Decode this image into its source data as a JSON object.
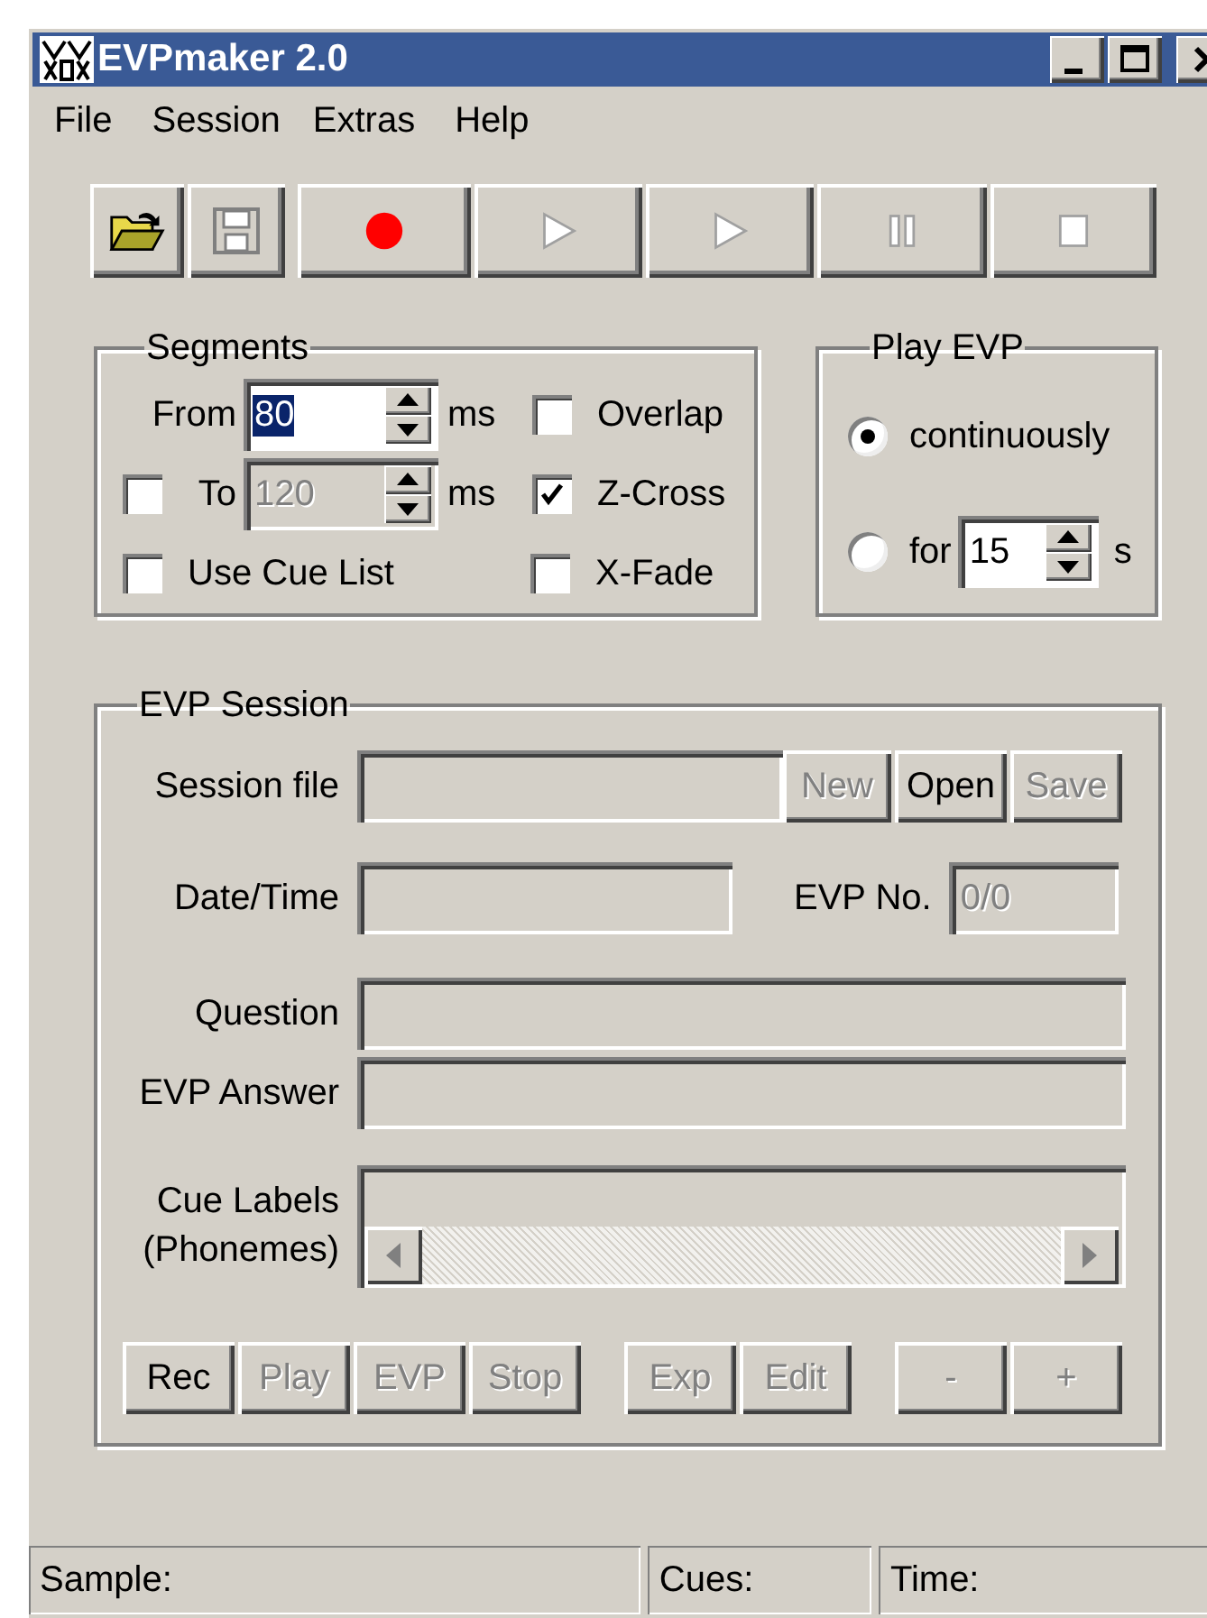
{
  "window": {
    "title": "EVPmaker 2.0"
  },
  "menu": [
    {
      "label": "File"
    },
    {
      "label": "Session"
    },
    {
      "label": "Extras"
    },
    {
      "label": "Help"
    }
  ],
  "toolbar": [
    {
      "kind": "open",
      "disabled": false
    },
    {
      "kind": "save",
      "disabled": true
    },
    {
      "kind": "record",
      "disabled": false
    },
    {
      "kind": "play",
      "disabled": true
    },
    {
      "kind": "play",
      "disabled": true
    },
    {
      "kind": "pause",
      "disabled": true
    },
    {
      "kind": "stop",
      "disabled": true
    }
  ],
  "segments": {
    "title": "Segments",
    "from": {
      "label": "From",
      "value": "80",
      "value_selected": true,
      "unit": "ms",
      "disabled": false
    },
    "to": {
      "label": "To",
      "checked": false,
      "value": "120",
      "unit": "ms",
      "disabled": true
    },
    "use_cue_list": {
      "label": "Use Cue List",
      "checked": false
    },
    "options": [
      {
        "label": "Overlap",
        "checked": false
      },
      {
        "label": "Z-Cross",
        "checked": true
      },
      {
        "label": "X-Fade",
        "checked": false
      }
    ]
  },
  "play_evp": {
    "title": "Play EVP",
    "options": [
      {
        "kind": "plain",
        "label": "continuously",
        "selected": true
      },
      {
        "kind": "duration",
        "label": "for",
        "selected": false,
        "value": "15",
        "unit": "s"
      }
    ]
  },
  "session": {
    "title": "EVP Session",
    "file": {
      "label": "Session file",
      "buttons": [
        {
          "label": "New",
          "disabled": true
        },
        {
          "label": "Open",
          "disabled": false
        },
        {
          "label": "Save",
          "disabled": true
        }
      ]
    },
    "date": {
      "label": "Date/Time"
    },
    "evp_no": {
      "label": "EVP No.",
      "value": "0/0"
    },
    "question": {
      "label": "Question"
    },
    "answer": {
      "label": "EVP Answer"
    },
    "cue_labels": {
      "label": "Cue Labels",
      "sublabel": "(Phonemes)"
    },
    "button_groups": [
      {
        "buttons": [
          {
            "label": "Rec",
            "disabled": false
          },
          {
            "label": "Play",
            "disabled": true
          },
          {
            "label": "EVP",
            "disabled": true
          },
          {
            "label": "Stop",
            "disabled": true
          }
        ]
      },
      {
        "buttons": [
          {
            "label": "Exp",
            "disabled": true
          },
          {
            "label": "Edit",
            "disabled": true
          }
        ]
      },
      {
        "buttons": [
          {
            "label": "-",
            "disabled": true
          },
          {
            "label": "+",
            "disabled": true
          }
        ]
      }
    ]
  },
  "status_bar": [
    "Sample:",
    "Cues:",
    "Time:"
  ]
}
